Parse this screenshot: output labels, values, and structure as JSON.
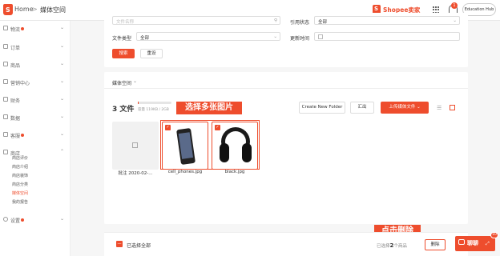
{
  "header": {
    "home_label": "Home",
    "sep": ">",
    "page": "媒体空间",
    "seller_brand": "Shopee卖家",
    "notif_count": "1",
    "hub_label": "Education Hub"
  },
  "sidebar": {
    "items": [
      {
        "label": "物流",
        "dot": true
      },
      {
        "label": "订单",
        "dot": false
      },
      {
        "label": "商品",
        "dot": false
      },
      {
        "label": "营销中心",
        "dot": false
      },
      {
        "label": "财务",
        "dot": false
      },
      {
        "label": "数据",
        "dot": false
      },
      {
        "label": "客服",
        "dot": true
      },
      {
        "label": "商店",
        "dot": false
      }
    ],
    "sub_items": [
      "商店评价",
      "商店介绍",
      "商店装饰",
      "商店分类",
      "媒体空间",
      "我的报告"
    ],
    "settings_label": "设置"
  },
  "filters": {
    "name_placeholder": "文件名称",
    "ref_label": "引用状态",
    "ref_value": "全部",
    "type_label": "文件类型",
    "type_value": "全部",
    "time_label": "更新时间",
    "search_btn": "搜索",
    "reset_btn": "重设"
  },
  "media": {
    "space_label": "媒体空间",
    "count_label": "3 文件",
    "storage_text": "容量 119KB / 2GB",
    "create_folder": "Create New Folder",
    "export_btn": "汇出",
    "upload_btn": "上传媒体文件",
    "files": [
      {
        "name": "批注 2020-02-..."
      },
      {
        "name": "cell_phones.jpg"
      },
      {
        "name": "black.jpg"
      }
    ]
  },
  "annotations": {
    "multi_select": "选择多张图片",
    "click_delete": "点击删除"
  },
  "footer": {
    "select_all": "已选择全部",
    "selected_text": "已选择",
    "selected_count": "2",
    "selected_suffix": "个商品",
    "delete_btn": "删除",
    "chat_label": "聊聊",
    "chat_badge": "10"
  },
  "colors": {
    "accent": "#ee4d2d"
  }
}
